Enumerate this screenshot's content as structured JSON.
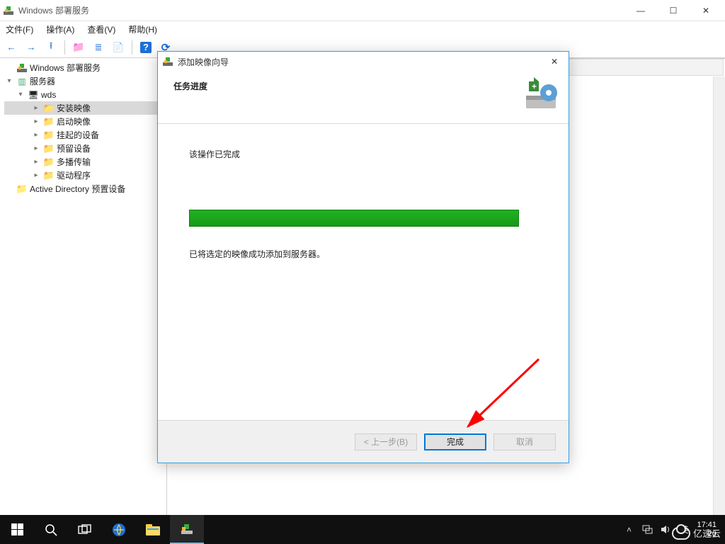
{
  "window": {
    "title": "Windows 部署服务",
    "controls": {
      "min": "—",
      "max": "☐",
      "close": "✕"
    }
  },
  "menubar": {
    "file": "文件(F)",
    "action": "操作(A)",
    "view": "查看(V)",
    "help": "帮助(H)"
  },
  "tree": {
    "root": "Windows 部署服务",
    "servers": "服务器",
    "host": "wds",
    "items": [
      "安装映像",
      "启动映像",
      "挂起的设备",
      "预留设备",
      "多播传输",
      "驱动程序"
    ],
    "ad": "Active Directory 预置设备"
  },
  "dialog": {
    "title": "添加映像向导",
    "headline": "任务进度",
    "status": "该操作已完成",
    "result": "已将选定的映像成功添加到服务器。",
    "buttons": {
      "back": "< 上一步(B)",
      "finish": "完成",
      "cancel": "取消"
    },
    "close": "✕"
  },
  "taskbar": {
    "ime": "英",
    "clock_time": "17:41",
    "clock_date": "20"
  },
  "watermark": "亿速云"
}
